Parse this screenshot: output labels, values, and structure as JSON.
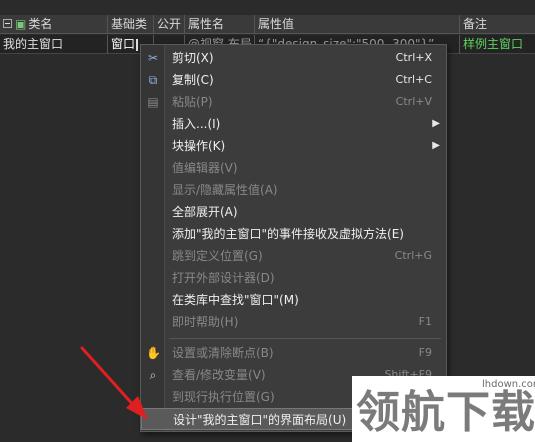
{
  "table": {
    "headers": [
      "类名",
      "基础类",
      "公开",
      "属性名",
      "属性值",
      "备注"
    ],
    "row": {
      "class_name": "我的主窗口",
      "base_class": "窗口",
      "attr_name": "@视窗.布局",
      "attr_value": "“{\"design_size\":\"500, 300\"}”",
      "note": "样例主窗口"
    }
  },
  "menu": {
    "items": [
      {
        "label": "剪切(X)",
        "shortcut": "Ctrl+X",
        "icon": "scissors-icon",
        "glyph": "✂",
        "disabled": false
      },
      {
        "label": "复制(C)",
        "shortcut": "Ctrl+C",
        "icon": "copy-icon",
        "glyph": "⧉",
        "disabled": false
      },
      {
        "label": "粘贴(P)",
        "shortcut": "Ctrl+V",
        "icon": "paste-icon",
        "glyph": "📋",
        "disabled": true
      },
      {
        "label": "插入...(I)",
        "shortcut": "",
        "submenu": true,
        "disabled": false
      },
      {
        "label": "块操作(K)",
        "shortcut": "",
        "submenu": true,
        "disabled": false
      },
      {
        "label": "值编辑器(V)",
        "shortcut": "",
        "disabled": true
      },
      {
        "label": "显示/隐藏属性值(A)",
        "shortcut": "",
        "disabled": true
      },
      {
        "label": "全部展开(A)",
        "shortcut": "",
        "disabled": false
      },
      {
        "label": "添加\"我的主窗口\"的事件接收及虚拟方法(E)",
        "shortcut": "",
        "disabled": false
      },
      {
        "label": "跳到定义位置(G)",
        "shortcut": "Ctrl+G",
        "disabled": true
      },
      {
        "label": "打开外部设计器(D)",
        "shortcut": "",
        "disabled": true
      },
      {
        "label": "在类库中查找\"窗口\"(M)",
        "shortcut": "",
        "disabled": false
      },
      {
        "label": "即时帮助(H)",
        "shortcut": "F1",
        "disabled": true
      },
      {
        "label": "设置或清除断点(B)",
        "shortcut": "F9",
        "icon": "hand-icon",
        "glyph": "✋",
        "disabled": true
      },
      {
        "label": "查看/修改变量(V)",
        "shortcut": "Shift+F9",
        "icon": "watch-icon",
        "glyph": "⌕",
        "disabled": true
      },
      {
        "label": "到现行执行位置(G)",
        "shortcut": "",
        "disabled": true
      },
      {
        "label": "设计\"我的主窗口\"的界面布局(U)",
        "shortcut": "",
        "disabled": false,
        "highlighted": true
      }
    ]
  },
  "watermark": {
    "text": "领航下载",
    "url": "lhdown.com"
  },
  "colors": {
    "background": "#2b2b2b",
    "menu_bg": "#3c3c3c",
    "note_green": "#5fd35f",
    "arrow_red": "#e02020"
  }
}
